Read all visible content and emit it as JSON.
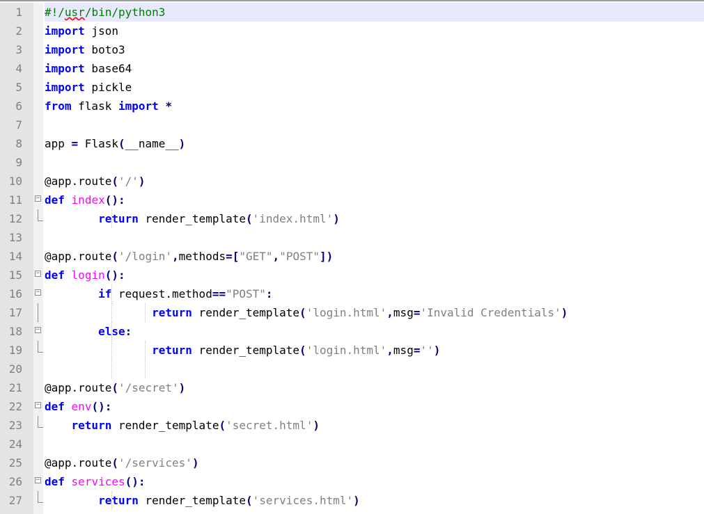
{
  "editor": {
    "lines": [
      {
        "n": "1",
        "parts": [
          {
            "t": "#!/",
            "c": "com"
          },
          {
            "t": "usr",
            "c": "com sq"
          },
          {
            "t": "/bin/python3",
            "c": "com"
          }
        ]
      },
      {
        "n": "2",
        "parts": [
          {
            "t": "import",
            "c": "kw"
          },
          {
            "t": " json",
            "c": ""
          }
        ]
      },
      {
        "n": "3",
        "parts": [
          {
            "t": "import",
            "c": "kw"
          },
          {
            "t": " boto3",
            "c": ""
          }
        ]
      },
      {
        "n": "4",
        "parts": [
          {
            "t": "import",
            "c": "kw"
          },
          {
            "t": " base64",
            "c": ""
          }
        ]
      },
      {
        "n": "5",
        "parts": [
          {
            "t": "import",
            "c": "kw"
          },
          {
            "t": " pickle",
            "c": ""
          }
        ]
      },
      {
        "n": "6",
        "parts": [
          {
            "t": "from",
            "c": "kw"
          },
          {
            "t": " flask ",
            "c": ""
          },
          {
            "t": "import",
            "c": "kw"
          },
          {
            "t": " ",
            "c": ""
          },
          {
            "t": "*",
            "c": "op"
          }
        ]
      },
      {
        "n": "7",
        "parts": []
      },
      {
        "n": "8",
        "parts": [
          {
            "t": "app ",
            "c": ""
          },
          {
            "t": "=",
            "c": "op"
          },
          {
            "t": " Flask",
            "c": ""
          },
          {
            "t": "(",
            "c": "op"
          },
          {
            "t": "__name__",
            "c": ""
          },
          {
            "t": ")",
            "c": "op"
          }
        ]
      },
      {
        "n": "9",
        "parts": []
      },
      {
        "n": "10",
        "parts": [
          {
            "t": "@app.route",
            "c": ""
          },
          {
            "t": "(",
            "c": "op"
          },
          {
            "t": "'/'",
            "c": "st"
          },
          {
            "t": ")",
            "c": "op"
          }
        ]
      },
      {
        "n": "11",
        "parts": [
          {
            "t": "def",
            "c": "kw"
          },
          {
            "t": " ",
            "c": ""
          },
          {
            "t": "index",
            "c": "fn"
          },
          {
            "t": "():",
            "c": "op"
          }
        ]
      },
      {
        "n": "12",
        "parts": [
          {
            "t": "        ",
            "c": ""
          },
          {
            "t": "return",
            "c": "kw"
          },
          {
            "t": " render_template",
            "c": ""
          },
          {
            "t": "(",
            "c": "op"
          },
          {
            "t": "'index.html'",
            "c": "st"
          },
          {
            "t": ")",
            "c": "op"
          }
        ]
      },
      {
        "n": "13",
        "parts": []
      },
      {
        "n": "14",
        "parts": [
          {
            "t": "@app.route",
            "c": ""
          },
          {
            "t": "(",
            "c": "op"
          },
          {
            "t": "'/login'",
            "c": "st"
          },
          {
            "t": ",",
            "c": "op"
          },
          {
            "t": "methods",
            "c": ""
          },
          {
            "t": "=[",
            "c": "op"
          },
          {
            "t": "\"GET\"",
            "c": "st"
          },
          {
            "t": ",",
            "c": "op"
          },
          {
            "t": "\"POST\"",
            "c": "st"
          },
          {
            "t": "])",
            "c": "op"
          }
        ]
      },
      {
        "n": "15",
        "parts": [
          {
            "t": "def",
            "c": "kw"
          },
          {
            "t": " ",
            "c": ""
          },
          {
            "t": "login",
            "c": "fn"
          },
          {
            "t": "():",
            "c": "op"
          }
        ]
      },
      {
        "n": "16",
        "parts": [
          {
            "t": "        ",
            "c": ""
          },
          {
            "t": "if",
            "c": "kw"
          },
          {
            "t": " request.method",
            "c": ""
          },
          {
            "t": "==",
            "c": "op"
          },
          {
            "t": "\"POST\"",
            "c": "st"
          },
          {
            "t": ":",
            "c": "op"
          }
        ]
      },
      {
        "n": "17",
        "parts": [
          {
            "t": "                ",
            "c": ""
          },
          {
            "t": "return",
            "c": "kw"
          },
          {
            "t": " render_template",
            "c": ""
          },
          {
            "t": "(",
            "c": "op"
          },
          {
            "t": "'login.html'",
            "c": "st"
          },
          {
            "t": ",",
            "c": "op"
          },
          {
            "t": "msg",
            "c": ""
          },
          {
            "t": "=",
            "c": "op"
          },
          {
            "t": "'Invalid Credentials'",
            "c": "st"
          },
          {
            "t": ")",
            "c": "op"
          }
        ]
      },
      {
        "n": "18",
        "parts": [
          {
            "t": "        ",
            "c": ""
          },
          {
            "t": "else",
            "c": "kw"
          },
          {
            "t": ":",
            "c": "op"
          }
        ]
      },
      {
        "n": "19",
        "parts": [
          {
            "t": "                ",
            "c": ""
          },
          {
            "t": "return",
            "c": "kw"
          },
          {
            "t": " render_template",
            "c": ""
          },
          {
            "t": "(",
            "c": "op"
          },
          {
            "t": "'login.html'",
            "c": "st"
          },
          {
            "t": ",",
            "c": "op"
          },
          {
            "t": "msg",
            "c": ""
          },
          {
            "t": "=",
            "c": "op"
          },
          {
            "t": "''",
            "c": "st"
          },
          {
            "t": ")",
            "c": "op"
          }
        ]
      },
      {
        "n": "20",
        "parts": []
      },
      {
        "n": "21",
        "parts": [
          {
            "t": "@app.route",
            "c": ""
          },
          {
            "t": "(",
            "c": "op"
          },
          {
            "t": "'/secret'",
            "c": "st"
          },
          {
            "t": ")",
            "c": "op"
          }
        ]
      },
      {
        "n": "22",
        "parts": [
          {
            "t": "def",
            "c": "kw"
          },
          {
            "t": " ",
            "c": ""
          },
          {
            "t": "env",
            "c": "fn"
          },
          {
            "t": "():",
            "c": "op"
          }
        ]
      },
      {
        "n": "23",
        "parts": [
          {
            "t": "    ",
            "c": ""
          },
          {
            "t": "return",
            "c": "kw"
          },
          {
            "t": " render_template",
            "c": ""
          },
          {
            "t": "(",
            "c": "op"
          },
          {
            "t": "'secret.html'",
            "c": "st"
          },
          {
            "t": ")",
            "c": "op"
          }
        ]
      },
      {
        "n": "24",
        "parts": []
      },
      {
        "n": "25",
        "parts": [
          {
            "t": "@app.route",
            "c": ""
          },
          {
            "t": "(",
            "c": "op"
          },
          {
            "t": "'/services'",
            "c": "st"
          },
          {
            "t": ")",
            "c": "op"
          }
        ]
      },
      {
        "n": "26",
        "parts": [
          {
            "t": "def",
            "c": "kw"
          },
          {
            "t": " ",
            "c": ""
          },
          {
            "t": "services",
            "c": "fn"
          },
          {
            "t": "():",
            "c": "op"
          }
        ]
      },
      {
        "n": "27",
        "parts": [
          {
            "t": "        ",
            "c": ""
          },
          {
            "t": "return",
            "c": "kw"
          },
          {
            "t": " render_template",
            "c": ""
          },
          {
            "t": "(",
            "c": "op"
          },
          {
            "t": "'services.html'",
            "c": "st"
          },
          {
            "t": ")",
            "c": "op"
          }
        ]
      }
    ]
  }
}
